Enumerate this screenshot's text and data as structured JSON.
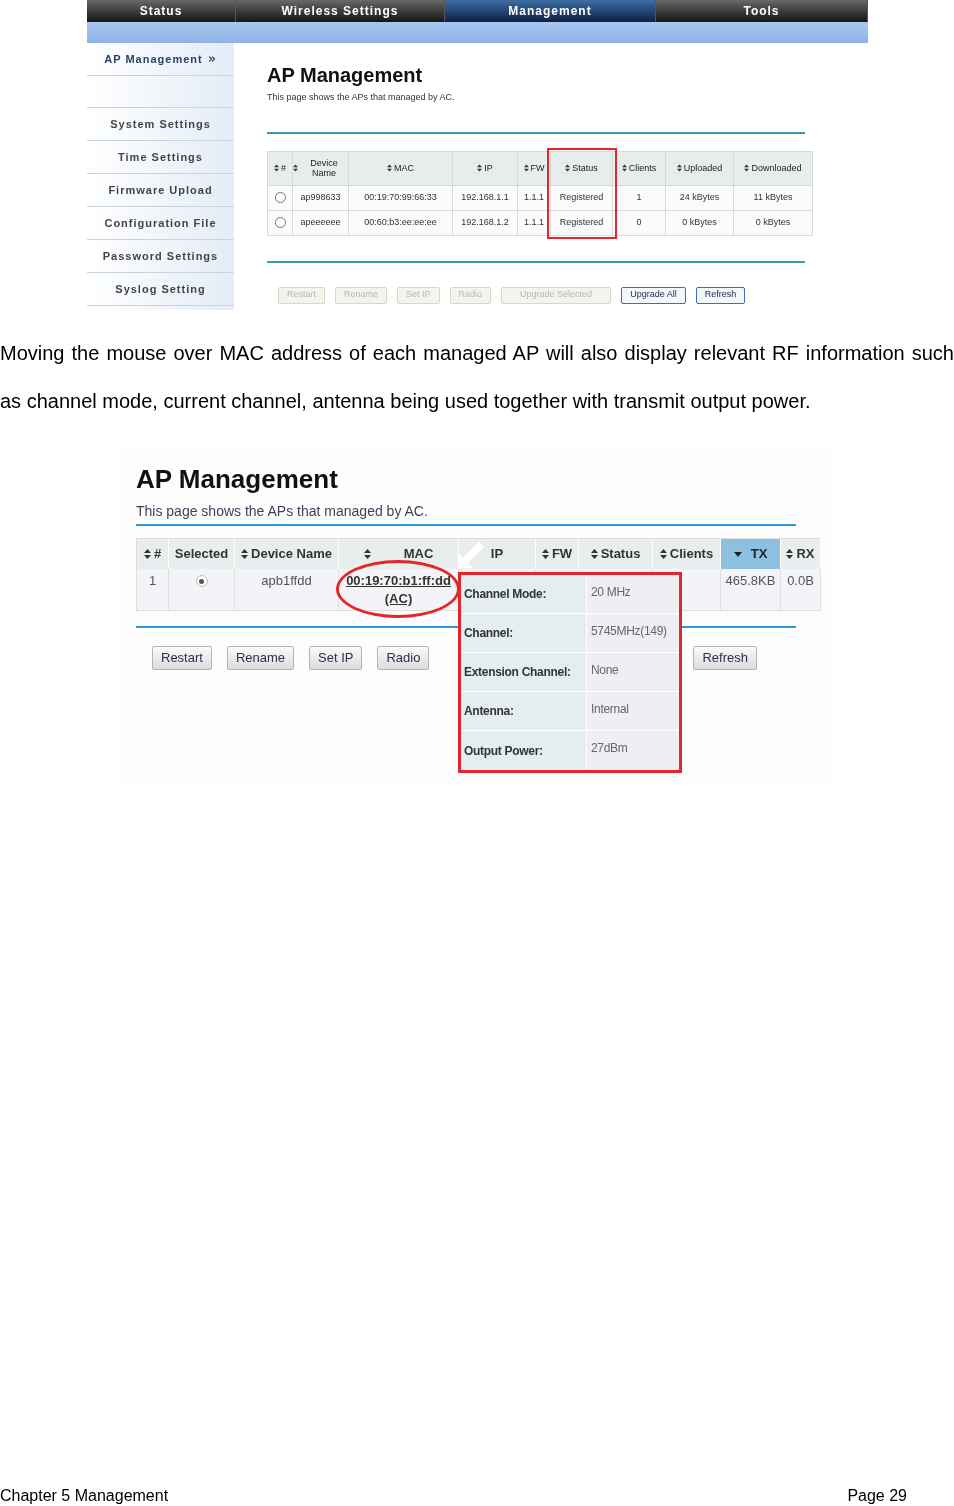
{
  "screenshot_1": {
    "nav_tabs": [
      {
        "label": "Status",
        "selected": false
      },
      {
        "label": "Wireless Settings",
        "selected": false
      },
      {
        "label": "Management",
        "selected": true
      },
      {
        "label": "Tools",
        "selected": false
      }
    ],
    "sidebar": {
      "items": [
        {
          "label": "AP Management",
          "selected": true
        },
        {
          "label": "System Settings",
          "selected": false
        },
        {
          "label": "Time Settings",
          "selected": false
        },
        {
          "label": "Firmware Upload",
          "selected": false
        },
        {
          "label": "Configuration File",
          "selected": false
        },
        {
          "label": "Password Settings",
          "selected": false
        },
        {
          "label": "Syslog Setting",
          "selected": false
        }
      ]
    },
    "title": "AP Management",
    "description": "This page shows the APs that managed by AC.",
    "table": {
      "columns": [
        {
          "label": "#",
          "sortable": true,
          "highlighted": false
        },
        {
          "label": "Device Name",
          "sortable": true,
          "highlighted": false
        },
        {
          "label": "MAC",
          "sortable": true,
          "highlighted": false
        },
        {
          "label": "IP",
          "sortable": true,
          "highlighted": false
        },
        {
          "label": "FW",
          "sortable": true,
          "highlighted": false
        },
        {
          "label": "Status",
          "sortable": true,
          "highlighted": true
        },
        {
          "label": "Clients",
          "sortable": true,
          "highlighted": false
        },
        {
          "label": "Uploaded",
          "sortable": true,
          "highlighted": false
        },
        {
          "label": "Downloaded",
          "sortable": true,
          "highlighted": false
        }
      ],
      "rows": [
        {
          "selected": false,
          "cells": [
            "",
            "ap998633",
            "00:19:70:99:66:33",
            "192.168.1.1",
            "1.1.1",
            "Registered",
            "1",
            "24 kBytes",
            "11 kBytes"
          ]
        },
        {
          "selected": false,
          "cells": [
            "",
            "apeeeeee",
            "00:60:b3:ee:ee:ee",
            "192.168.1.2",
            "1.1.1",
            "Registered",
            "0",
            "0 kBytes",
            "0 kBytes"
          ]
        }
      ]
    },
    "buttons": [
      {
        "label": "Restart",
        "disabled": true
      },
      {
        "label": "Rename",
        "disabled": true
      },
      {
        "label": "Set IP",
        "disabled": true
      },
      {
        "label": "Radio",
        "disabled": true
      },
      {
        "label": "Upgrade Selected",
        "disabled": true
      },
      {
        "label": "Upgrade All",
        "disabled": false
      },
      {
        "label": "Refresh",
        "disabled": false
      }
    ]
  },
  "paragraph": "Moving the mouse over MAC address of each managed AP will also display relevant RF information such as channel mode, current channel, antenna being used together with transmit output power.",
  "screenshot_2": {
    "title": "AP Management",
    "description": "This page shows the APs that managed by AC.",
    "table": {
      "columns": [
        {
          "label": "#",
          "sortable": true,
          "sorted": false
        },
        {
          "label": "Selected",
          "sortable": false,
          "sorted": false
        },
        {
          "label": "Device Name",
          "sortable": true,
          "sorted": false
        },
        {
          "label": "MAC",
          "sortable": true,
          "sorted": false
        },
        {
          "label": "IP",
          "sortable": false,
          "sorted": false
        },
        {
          "label": "FW",
          "sortable": true,
          "sorted": false
        },
        {
          "label": "Status",
          "sortable": true,
          "sorted": false
        },
        {
          "label": "Clients",
          "sortable": true,
          "sorted": false
        },
        {
          "label": "TX",
          "sorted": true
        },
        {
          "label": "RX",
          "sortable": true,
          "sorted": false
        }
      ],
      "rows": [
        {
          "number": "1",
          "selected": true,
          "device_name": "apb1ffdd",
          "mac": "00:19:70:b1:ff:dd (AC)",
          "mac_circled": true,
          "tx": "465.8KB",
          "rx": "0.0B"
        }
      ]
    },
    "tooltip": {
      "rows": [
        {
          "label": "Channel Mode:",
          "value": "20 MHz"
        },
        {
          "label": "Channel:",
          "value": "5745MHz(149)"
        },
        {
          "label": "Extension Channel:",
          "value": "None"
        },
        {
          "label": "Antenna:",
          "value": "Internal"
        },
        {
          "label": "Output Power:",
          "value": "27dBm"
        }
      ]
    },
    "buttons": [
      {
        "label": "Restart",
        "disabled": false
      },
      {
        "label": "Rename",
        "disabled": false
      },
      {
        "label": "Set IP",
        "disabled": false
      },
      {
        "label": "Radio",
        "disabled": false
      },
      {
        "label": "Refresh",
        "disabled": false
      }
    ]
  },
  "footer": {
    "chapter": "Chapter 5 Management",
    "page": "Page 29"
  }
}
